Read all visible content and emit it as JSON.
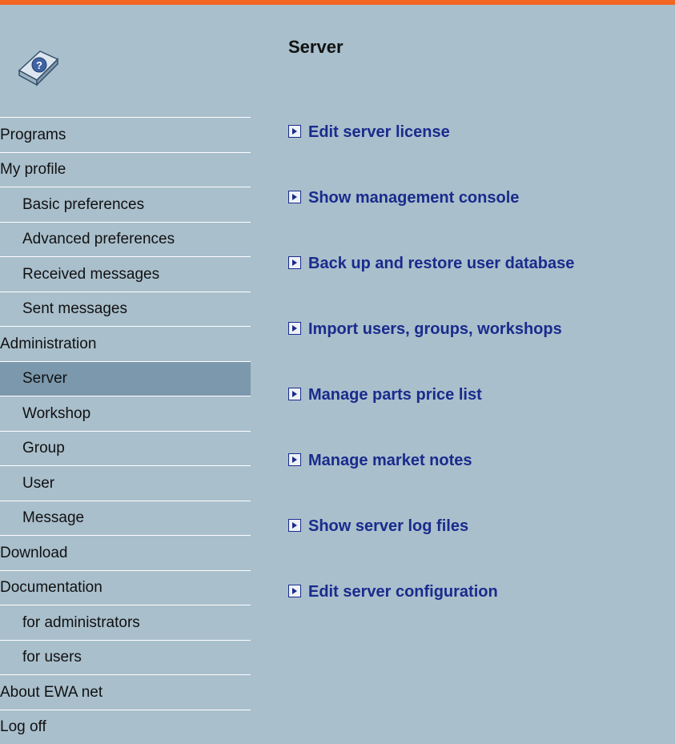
{
  "header": {
    "accent_color": "#f26522"
  },
  "logo": {
    "icon": "help-book-icon"
  },
  "sidebar": {
    "items": [
      {
        "label": "Programs",
        "level": 0,
        "active": false
      },
      {
        "label": "My profile",
        "level": 0,
        "active": false
      },
      {
        "label": "Basic preferences",
        "level": 1,
        "active": false
      },
      {
        "label": "Advanced preferences",
        "level": 1,
        "active": false
      },
      {
        "label": "Received messages",
        "level": 1,
        "active": false
      },
      {
        "label": "Sent messages",
        "level": 1,
        "active": false
      },
      {
        "label": "Administration",
        "level": 0,
        "active": false
      },
      {
        "label": "Server",
        "level": 1,
        "active": true
      },
      {
        "label": "Workshop",
        "level": 1,
        "active": false
      },
      {
        "label": "Group",
        "level": 1,
        "active": false
      },
      {
        "label": "User",
        "level": 1,
        "active": false
      },
      {
        "label": "Message",
        "level": 1,
        "active": false
      },
      {
        "label": "Download",
        "level": 0,
        "active": false
      },
      {
        "label": "Documentation",
        "level": 0,
        "active": false
      },
      {
        "label": "for administrators",
        "level": 1,
        "active": false
      },
      {
        "label": "for users",
        "level": 1,
        "active": false
      },
      {
        "label": "About EWA net",
        "level": 0,
        "active": false
      },
      {
        "label": "Log off",
        "level": 0,
        "active": false
      }
    ]
  },
  "main": {
    "title": "Server",
    "links": [
      {
        "label": "Edit server license",
        "icon": "arrow-right-icon"
      },
      {
        "label": "Show management console",
        "icon": "arrow-right-icon"
      },
      {
        "label": "Back up and restore user database",
        "icon": "arrow-right-icon"
      },
      {
        "label": "Import users, groups, workshops",
        "icon": "arrow-right-icon"
      },
      {
        "label": "Manage parts price list",
        "icon": "arrow-right-icon"
      },
      {
        "label": "Manage market notes",
        "icon": "arrow-right-icon"
      },
      {
        "label": "Show server log files",
        "icon": "arrow-right-icon"
      },
      {
        "label": "Edit server configuration",
        "icon": "arrow-right-icon"
      }
    ]
  },
  "colors": {
    "background": "#a9bfcc",
    "active_item": "#7b98ac",
    "link": "#1a2b8c"
  }
}
